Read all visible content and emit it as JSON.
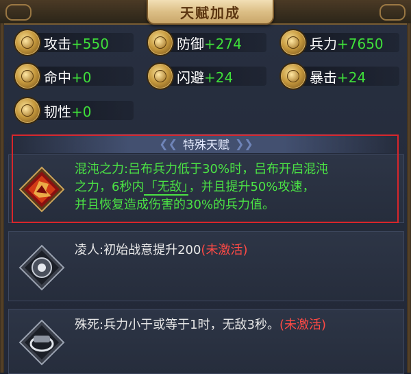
{
  "header": {
    "title": "天赋加成"
  },
  "stats": [
    {
      "name": "攻击",
      "value": "+550"
    },
    {
      "name": "防御",
      "value": "+274"
    },
    {
      "name": "兵力",
      "value": "+7650"
    },
    {
      "name": "命中",
      "value": "+0"
    },
    {
      "name": "闪避",
      "value": "+24"
    },
    {
      "name": "暴击",
      "value": "+24"
    },
    {
      "name": "韧性",
      "value": "+0"
    }
  ],
  "special": {
    "heading": "特殊天赋",
    "talents": [
      {
        "line1": "混沌之力:吕布兵力低于30%时，吕布开启混沌",
        "line2a": "之力，6秒内",
        "line2b": "「无敌」",
        "line2c": "，并且提升50%攻速，",
        "line3": "并且恢复造成伤害的30%的兵力值。",
        "active": true
      },
      {
        "text": "凌人:初始战意提升200",
        "status": "(未激活)"
      },
      {
        "text": "殊死:兵力小于或等于1时，无敌3秒。",
        "status": "(未激活)"
      }
    ]
  },
  "colors": {
    "stat_value": "#3fe03a",
    "active_text": "#4be344",
    "inactive_status": "#ff4a45",
    "highlight_border": "#d8262b"
  }
}
